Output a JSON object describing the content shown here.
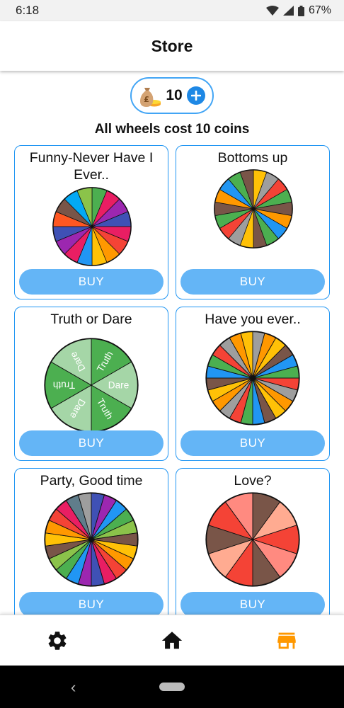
{
  "status": {
    "time": "6:18",
    "battery": "67%"
  },
  "header": {
    "title": "Store"
  },
  "coins": {
    "count": "10",
    "icon": "money-bag-icon"
  },
  "cost_notice": "All wheels cost 10 coins",
  "buy_label": "BUY",
  "wheels": [
    {
      "title": "Funny-Never Have I Ever..",
      "colors": [
        "#4caf50",
        "#e91e63",
        "#9c27b0",
        "#3f51b5",
        "#e91e63",
        "#f44336",
        "#ff9800",
        "#ffc107",
        "#2196f3",
        "#e91e63",
        "#9c27b0",
        "#3f51b5",
        "#ff5722",
        "#795548",
        "#03a9f4",
        "#8bc34a"
      ]
    },
    {
      "title": "Bottoms up",
      "colors": [
        "#ffc107",
        "#9e9e9e",
        "#f44336",
        "#4caf50",
        "#795548",
        "#ff9800",
        "#2196f3",
        "#4caf50",
        "#795548",
        "#ffc107",
        "#9e9e9e",
        "#f44336",
        "#4caf50",
        "#795548",
        "#ff9800",
        "#2196f3",
        "#4caf50",
        "#795548"
      ]
    },
    {
      "title": "Truth or Dare",
      "segments": [
        "Truth",
        "Dare",
        "Truth",
        "Dare",
        "Truth",
        "Dare"
      ],
      "colors": [
        "#4caf50",
        "#a5d6a7",
        "#4caf50",
        "#a5d6a7",
        "#4caf50",
        "#a5d6a7"
      ]
    },
    {
      "title": "Have you ever..",
      "colors": [
        "#9e9e9e",
        "#ff9800",
        "#ffc107",
        "#795548",
        "#2196f3",
        "#4caf50",
        "#f44336",
        "#9e9e9e",
        "#ff9800",
        "#ffc107",
        "#795548",
        "#2196f3",
        "#4caf50",
        "#f44336",
        "#9e9e9e",
        "#ff9800",
        "#ffc107",
        "#795548",
        "#2196f3",
        "#4caf50",
        "#f44336",
        "#9e9e9e",
        "#ff9800",
        "#ffc107"
      ]
    },
    {
      "title": "Party, Good time",
      "colors": [
        "#3f51b5",
        "#9c27b0",
        "#2196f3",
        "#4caf50",
        "#8bc34a",
        "#795548",
        "#ffc107",
        "#ff9800",
        "#f44336",
        "#e91e63",
        "#3f51b5",
        "#9c27b0",
        "#2196f3",
        "#4caf50",
        "#8bc34a",
        "#795548",
        "#ffc107",
        "#ff9800",
        "#f44336",
        "#e91e63",
        "#607d8b",
        "#9e9e9e"
      ]
    },
    {
      "title": "Love?",
      "colors": [
        "#795548",
        "#ffab91",
        "#f44336",
        "#ff8a80",
        "#795548",
        "#f44336",
        "#ffab91",
        "#795548",
        "#f44336",
        "#ff8a80"
      ]
    }
  ],
  "nav": {
    "settings": "gear-icon",
    "home": "home-icon",
    "store": "store-icon",
    "active_color": "#ff9800"
  }
}
